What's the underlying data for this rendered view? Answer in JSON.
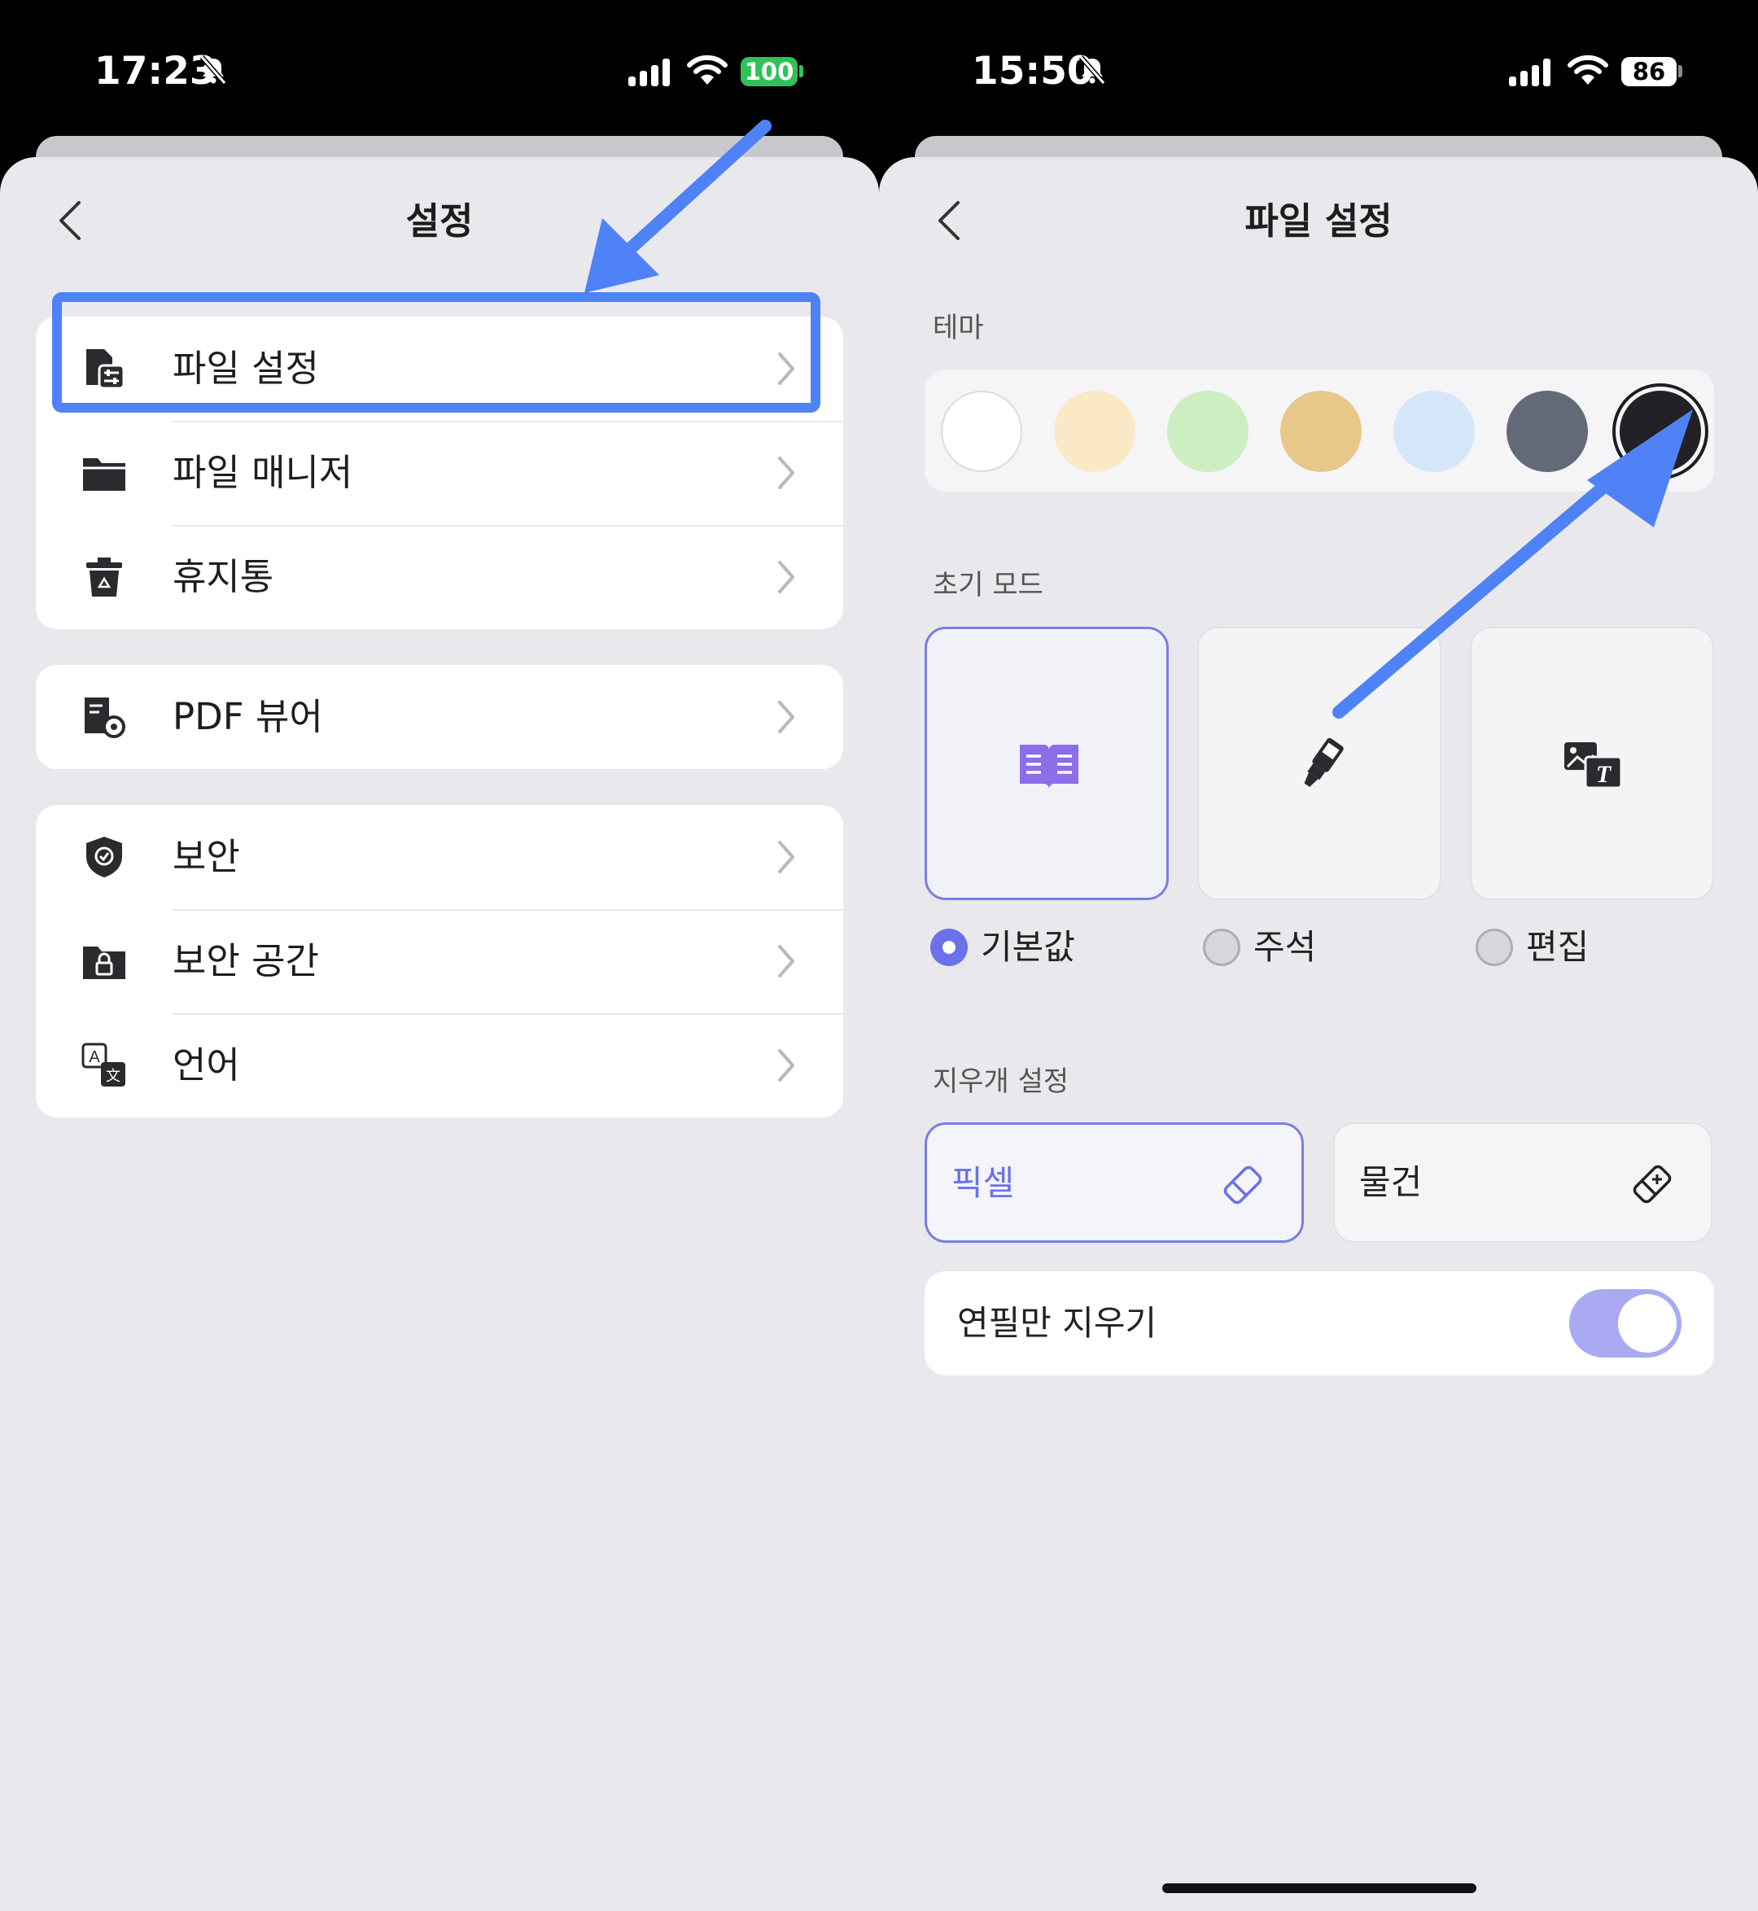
{
  "left": {
    "status": {
      "time": "17:23",
      "battery": "100"
    },
    "title": "설정",
    "groups": [
      {
        "items": [
          {
            "label": "파일 설정",
            "icon": "file-settings-icon"
          },
          {
            "label": "파일 매니저",
            "icon": "folder-icon"
          },
          {
            "label": "휴지통",
            "icon": "trash-icon"
          }
        ]
      },
      {
        "items": [
          {
            "label": "PDF 뷰어",
            "icon": "pdf-viewer-icon"
          }
        ]
      },
      {
        "items": [
          {
            "label": "보안",
            "icon": "shield-icon"
          },
          {
            "label": "보안 공간",
            "icon": "secure-folder-icon"
          },
          {
            "label": "언어",
            "icon": "language-icon"
          }
        ]
      }
    ],
    "annotation": {
      "highlight_color": "#4f82f6",
      "highlighted_item": "파일 설정"
    }
  },
  "right": {
    "status": {
      "time": "15:50",
      "battery": "86"
    },
    "title": "파일 설정",
    "theme": {
      "label": "테마",
      "swatches": [
        "#ffffff",
        "#fbe8c6",
        "#cdeec1",
        "#e8c78a",
        "#d5e6f8",
        "#636a78",
        "#222226"
      ],
      "selected_index": 6
    },
    "initial_mode": {
      "label": "초기 모드",
      "options": [
        {
          "label": "기본값",
          "icon": "book-icon",
          "selected": true
        },
        {
          "label": "주석",
          "icon": "highlighter-icon",
          "selected": false
        },
        {
          "label": "편집",
          "icon": "edit-text-image-icon",
          "selected": false
        }
      ]
    },
    "eraser": {
      "label": "지우개 설정",
      "options": [
        {
          "label": "픽셀",
          "icon": "pixel-eraser-icon",
          "selected": true
        },
        {
          "label": "물건",
          "icon": "object-eraser-icon",
          "selected": false
        }
      ]
    },
    "pencil_only": {
      "label": "연필만 지우기",
      "enabled": true
    }
  },
  "colors": {
    "accent": "#6c70ea",
    "accent_light": "#a9aaf2",
    "arrow": "#4f82f6",
    "sheet_bg": "#e9e9ed"
  }
}
